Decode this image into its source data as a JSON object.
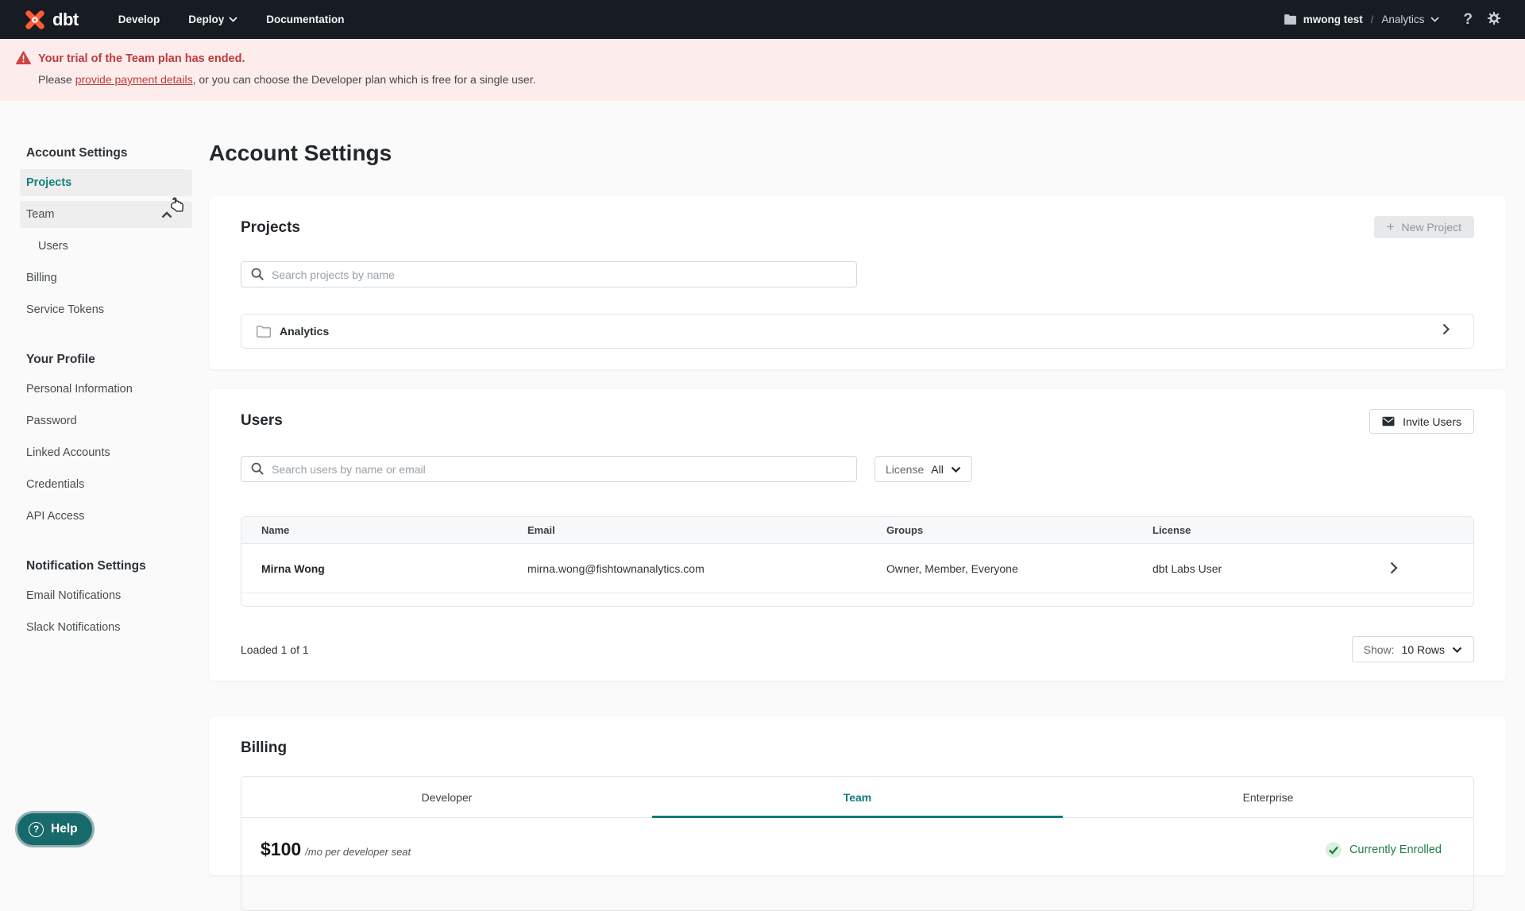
{
  "nav": {
    "brand": "dbt",
    "links": [
      {
        "label": "Develop"
      },
      {
        "label": "Deploy"
      },
      {
        "label": "Documentation"
      }
    ],
    "account": "mwong test",
    "separator": "/",
    "project": "Analytics",
    "help_glyph": "?"
  },
  "banner": {
    "title": "Your trial of the Team plan has ended.",
    "body_prefix": "Please ",
    "link": "provide payment details",
    "body_suffix": ", or you can choose the Developer plan which is free for a single user."
  },
  "sidebar": {
    "sections": [
      {
        "heading": "Account Settings",
        "items": [
          {
            "label": "Projects"
          },
          {
            "label": "Team"
          },
          {
            "label": "Users"
          },
          {
            "label": "Billing"
          },
          {
            "label": "Service Tokens"
          }
        ]
      },
      {
        "heading": "Your Profile",
        "items": [
          {
            "label": "Personal Information"
          },
          {
            "label": "Password"
          },
          {
            "label": "Linked Accounts"
          },
          {
            "label": "Credentials"
          },
          {
            "label": "API Access"
          }
        ]
      },
      {
        "heading": "Notification Settings",
        "items": [
          {
            "label": "Email Notifications"
          },
          {
            "label": "Slack Notifications"
          }
        ]
      }
    ]
  },
  "page_title": "Account Settings",
  "projects": {
    "heading": "Projects",
    "new_button": "New Project",
    "plus_glyph": "+",
    "search_placeholder": "Search projects by name",
    "row_name": "Analytics"
  },
  "users": {
    "heading": "Users",
    "invite_button": "Invite Users",
    "search_placeholder": "Search users by name or email",
    "license_label": "License",
    "license_value": "All",
    "columns": {
      "name": "Name",
      "email": "Email",
      "groups": "Groups",
      "license": "License"
    },
    "row": {
      "name": "Mirna Wong",
      "email": "mirna.wong@fishtownanalytics.com",
      "groups": "Owner, Member, Everyone",
      "license": "dbt Labs User"
    },
    "loaded": "Loaded 1 of 1",
    "show_label": "Show:",
    "show_value": "10 Rows"
  },
  "billing": {
    "heading": "Billing",
    "tabs": [
      {
        "label": "Developer"
      },
      {
        "label": "Team"
      },
      {
        "label": "Enterprise"
      }
    ],
    "price": "$100",
    "price_suffix": "/mo per developer seat",
    "enrolled": "Currently Enrolled"
  },
  "help": {
    "label": "Help",
    "glyph": "?"
  },
  "colors": {
    "accent_teal": "#0e7d78",
    "brand_orange": "#ff5c35",
    "alert_red": "#bf3a3a",
    "enrolled_green": "#1f7e44",
    "nav_bg": "#171c23",
    "banner_bg": "#fcecec"
  }
}
